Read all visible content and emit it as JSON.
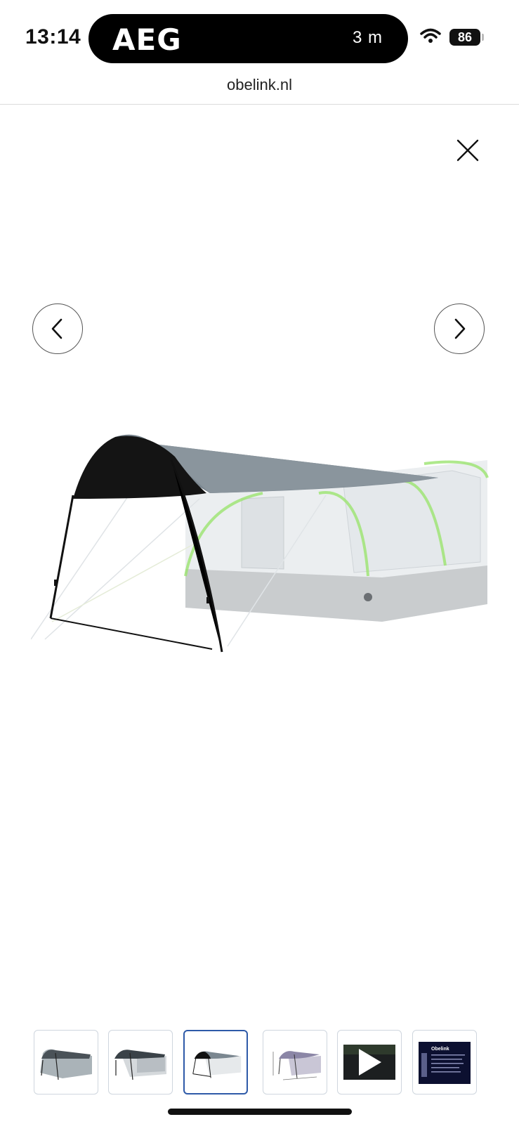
{
  "status_bar": {
    "time": "13:14",
    "island_brand": "AEG",
    "island_meta": "3 m",
    "battery": "86"
  },
  "browser": {
    "url": "obelink.nl"
  },
  "gallery": {
    "selected_index": 3,
    "thumbnails": [
      {
        "kind": "image",
        "icon": "tent-canopy-grey"
      },
      {
        "kind": "image",
        "icon": "tent-canopy-grey"
      },
      {
        "kind": "image",
        "icon": "tent-canopy-dark"
      },
      {
        "kind": "image",
        "icon": "tent-dimensions"
      },
      {
        "kind": "video",
        "icon": "play-icon"
      },
      {
        "kind": "image",
        "icon": "product-info-sheet",
        "brand_text": "Obelink"
      }
    ]
  },
  "colors": {
    "accent": "#2e5aa8",
    "canopy_top": "#7b8790",
    "canopy_dark": "#111111",
    "tent_trim": "#9be36f"
  }
}
